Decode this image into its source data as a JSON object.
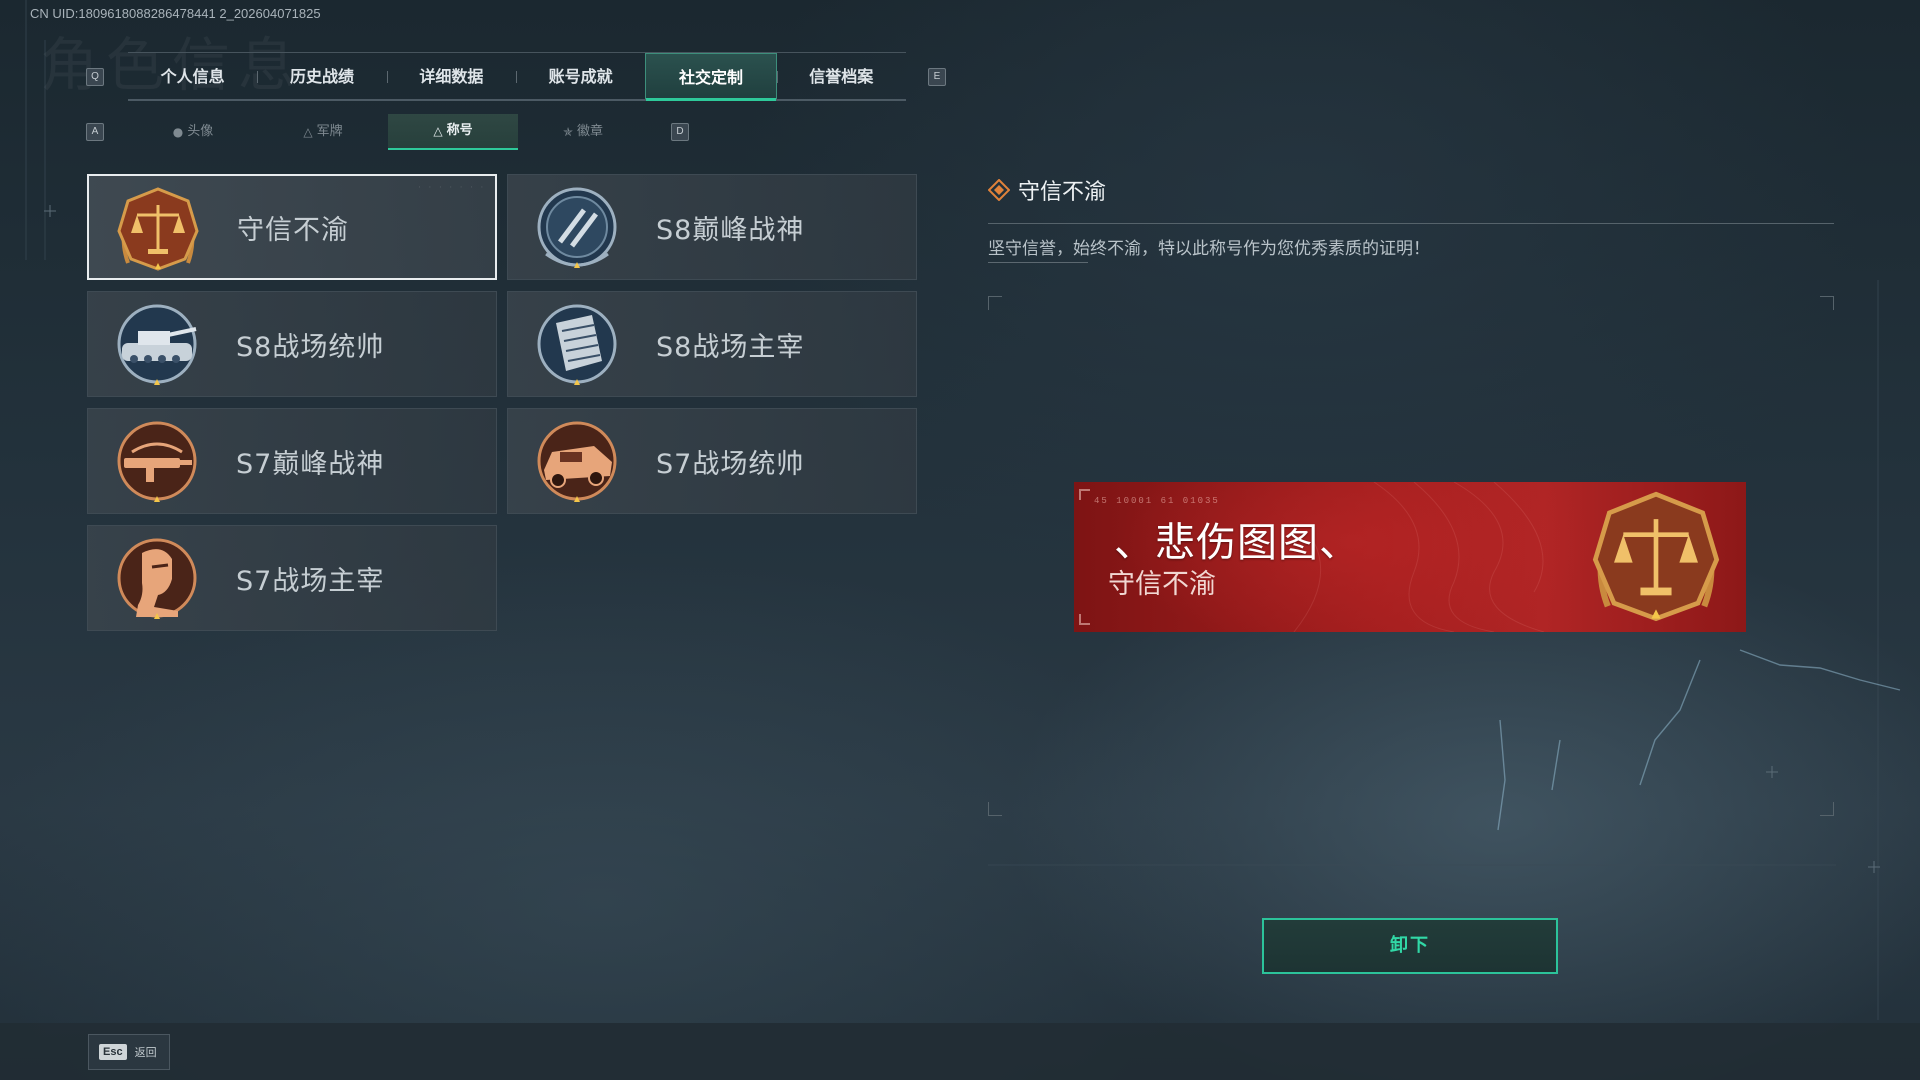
{
  "uid_text": "CN UID:1809618088286478441 2_202604071825",
  "watermark": "角色信息",
  "keys": {
    "prev_tab": "Q",
    "next_tab": "E",
    "prev_sub": "A",
    "next_sub": "D",
    "back": "Esc"
  },
  "tabs": [
    {
      "label": "个人信息",
      "active": false
    },
    {
      "label": "历史战绩",
      "active": false
    },
    {
      "label": "详细数据",
      "active": false
    },
    {
      "label": "账号成就",
      "active": false
    },
    {
      "label": "社交定制",
      "active": true
    },
    {
      "label": "信誉档案",
      "active": false
    }
  ],
  "subtabs": [
    {
      "label": "头像",
      "icon": "person-icon",
      "active": false
    },
    {
      "label": "军牌",
      "icon": "dogtag-icon",
      "active": false
    },
    {
      "label": "称号",
      "icon": "triangle-icon",
      "active": true
    },
    {
      "label": "徽章",
      "icon": "badge-icon",
      "active": false
    }
  ],
  "titles": [
    {
      "label": "守信不渝",
      "emblem": "scales-emblem-icon",
      "selected": true
    },
    {
      "label": "S8巅峰战神",
      "emblem": "s8-peak-emblem-icon",
      "selected": false
    },
    {
      "label": "S8战场统帅",
      "emblem": "s8-tank-emblem-icon",
      "selected": false
    },
    {
      "label": "S8战场主宰",
      "emblem": "s8-building-emblem-icon",
      "selected": false
    },
    {
      "label": "S7巅峰战神",
      "emblem": "s7-gun-emblem-icon",
      "selected": false
    },
    {
      "label": "S7战场统帅",
      "emblem": "s7-vehicle-emblem-icon",
      "selected": false
    },
    {
      "label": "S7战场主宰",
      "emblem": "s7-soldier-emblem-icon",
      "selected": false
    }
  ],
  "detail": {
    "title": "守信不渝",
    "description": "坚守信誉，始终不渝，特以此称号作为您优秀素质的证明！"
  },
  "nameplate": {
    "player_name": "、悲伤图图、",
    "title": "守信不渝",
    "code": "45 10001 61 01035"
  },
  "unequip_label": "卸下",
  "back_label": "返回",
  "colors": {
    "accent": "#2ec99a",
    "plate_red": "#a31e1e",
    "bronze": "#c98a3e"
  }
}
